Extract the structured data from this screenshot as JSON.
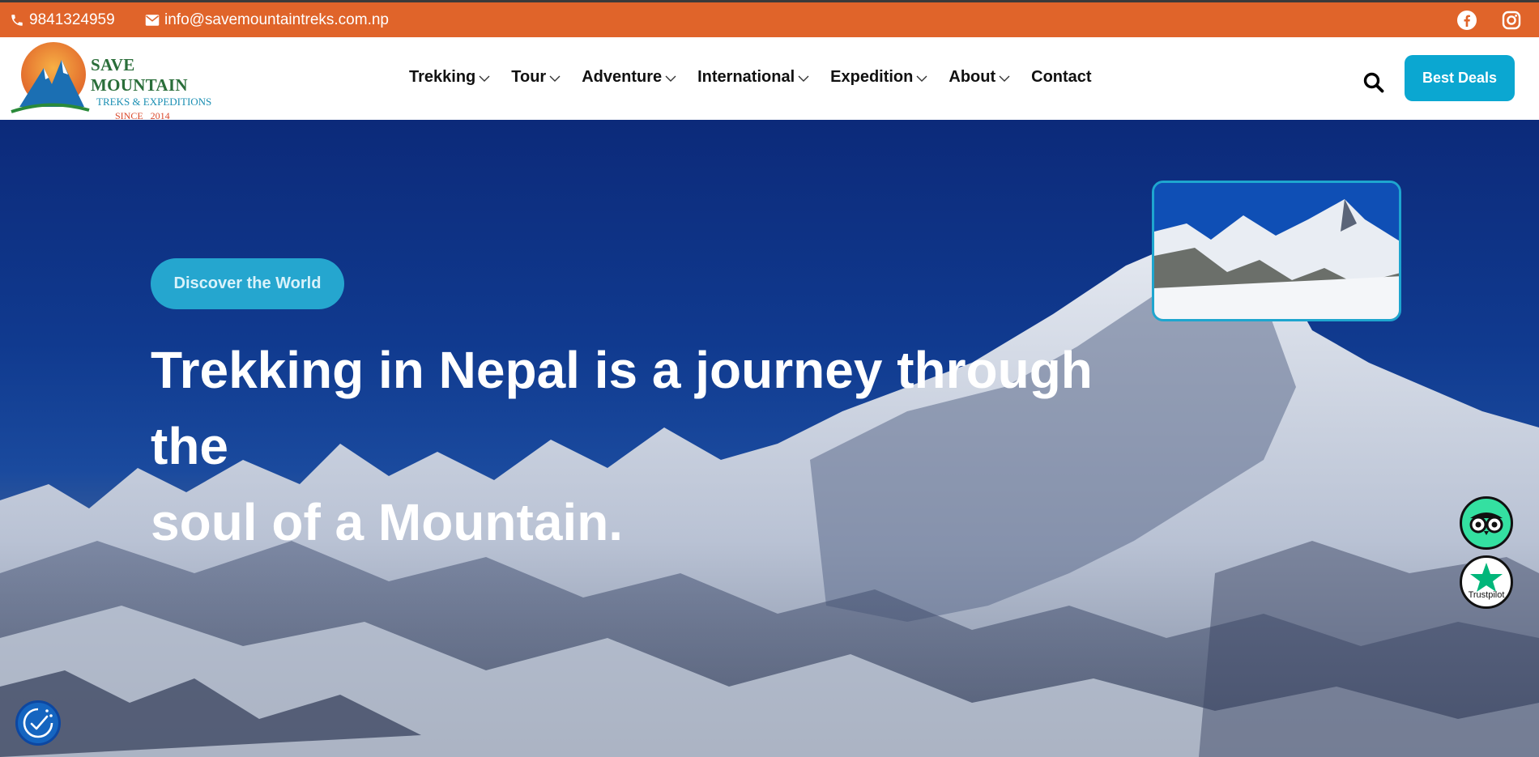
{
  "topbar": {
    "phone": "9841324959",
    "email": "info@savemountaintreks.com.np",
    "social": [
      "facebook-icon",
      "instagram-icon"
    ]
  },
  "logo": {
    "title": "SAVE MOUNTAIN",
    "subtitle": "TREKS & EXPEDITIONS",
    "since": "SINCE   2014"
  },
  "nav": {
    "items": [
      {
        "label": "Trekking",
        "dropdown": true
      },
      {
        "label": "Tour",
        "dropdown": true
      },
      {
        "label": "Adventure",
        "dropdown": true
      },
      {
        "label": "International",
        "dropdown": true
      },
      {
        "label": "Expedition",
        "dropdown": true
      },
      {
        "label": "About",
        "dropdown": true
      },
      {
        "label": "Contact",
        "dropdown": false
      }
    ],
    "search_icon": "search-icon",
    "deals_label": "Best Deals"
  },
  "hero": {
    "tag": "Discover the World",
    "headline_line1": "Trekking in Nepal is a journey through the",
    "headline_line2": "soul of a Mountain."
  },
  "badges": {
    "tripadvisor": "tripadvisor-icon",
    "trustpilot_label": "Trustpilot"
  },
  "colors": {
    "topbar": "#e0642a",
    "accent": "#0ba7d1",
    "tag_bg": "#25a6cf",
    "tripadvisor": "#34e0a1"
  }
}
